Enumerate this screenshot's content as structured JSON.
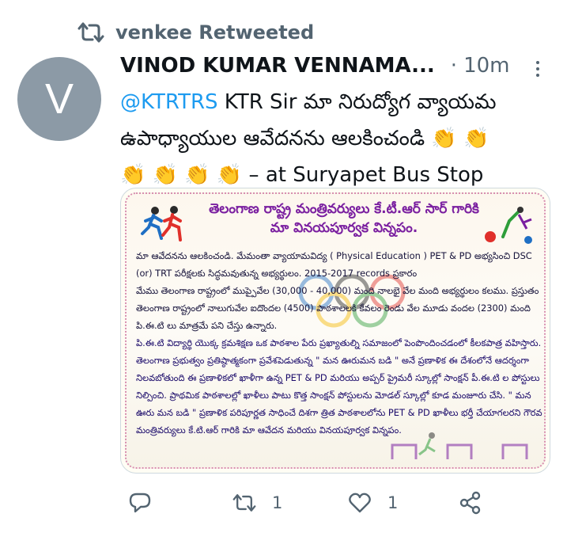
{
  "retweet_context": {
    "icon": "retweet-icon",
    "text": "venkee Retweeted"
  },
  "avatar": {
    "letter": "V",
    "color": "#8c9aa6"
  },
  "tweet": {
    "author": "VINOD KUMAR VENNAMA...",
    "separator": "·",
    "time": "10m",
    "mention": "@KTRTRS",
    "text_line1_rest": " KTR Sir మా నిరుద్యోగ వ్యాయమ",
    "text_line2": "ఉపాధ్యాయుల ఆవేదనను ఆలకించండి ",
    "claps_line2": "👏 👏",
    "claps_line3": "👏 👏 👏 👏",
    "location": " – at Suryapet Bus Stop"
  },
  "media": {
    "title_line1": "తెలంగాణ రాష్ట్ర మంత్రివర్యులు కే.టీ.ఆర్ సార్ గారికి",
    "title_line2": "మా వినయపూర్వక విన్నపం.",
    "para1": "మా ఆవేదనను ఆలకించండి. మేమంతా వ్యాయామవిద్య ( Physical Education ) PET & PD అభ్యసించి DSC (or) TRT పరీక్షలకు సిద్ధమవుతున్న అభ్యర్థులం. 2015-2017 records ప్రకారం",
    "para2": "మేము తెలంగాణ రాష్ట్రంలో ముప్పైవేల (30,000 - 40,000) మంది నాలభై వేల మంది అభ్యర్థులం కలము. ప్రస్తుతం తెలంగాణ రాష్ట్రంలో నాలుగువేల ఐదొందల (4500) పాఠశాలలకి కేవలం రెండు వేల మూడు వందల (2300) మంది పి.ఈ.టి లు మాత్రమే పని చేస్తు ఉన్నారు.",
    "para3": "పి.ఈ.టి విద్యార్థి యొక్క క్రమశిక్షణ ఒక పాఠశాల పేరు ప్రఖ్యాతుల్ని సమాజంలో పెంపొందించడంలో కీలకపాత్ర వహిస్తారు. తెలంగాణ ప్రభుత్వం ప్రతిష్ఠాత్మకంగా ప్రవేశపెడుతున్న \" మన ఊరుమన బడి \" అనే ప్రణాళిక ఈ దేశంలోనే ఆదర్శంగా నిలవబోతుంది ఈ ప్రణాళికలో ఖాళీగా ఉన్న PET & PD మరియు అప్పర్ ప్రైమరీ స్కూల్లో సాంక్షన్ పీ.ఈ.టి ల పోస్టులు నిల్పించి. ప్రాథమిక పాఠశాలల్లో ఖాళీలు పాటు కొత్త సాంక్షన్ పోస్టులను మోడల్ స్కూల్లో కూడ మంజూరు చేసి. \" మన ఊరు మన బడి \" ప్రణాళిక పరిపూర్ణత సాధించే దిశగా త్రిత పాఠశాలలోను PET & PD ఖాళీలు భర్తీ చేయాగలరని గౌరవ మంత్రివర్యులు కే.టి.ఆర్ గారికి మా ఆవేదన మరియు వినయపూర్వక విన్నపం."
  },
  "actions": {
    "reply_icon": "reply-icon",
    "retweet_icon": "retweet-icon",
    "retweet_count": "1",
    "like_icon": "heart-icon",
    "like_count": "1",
    "share_icon": "share-icon"
  },
  "colors": {
    "accent": "#1d9bf0",
    "muted": "#536471",
    "text": "#0f1419"
  }
}
